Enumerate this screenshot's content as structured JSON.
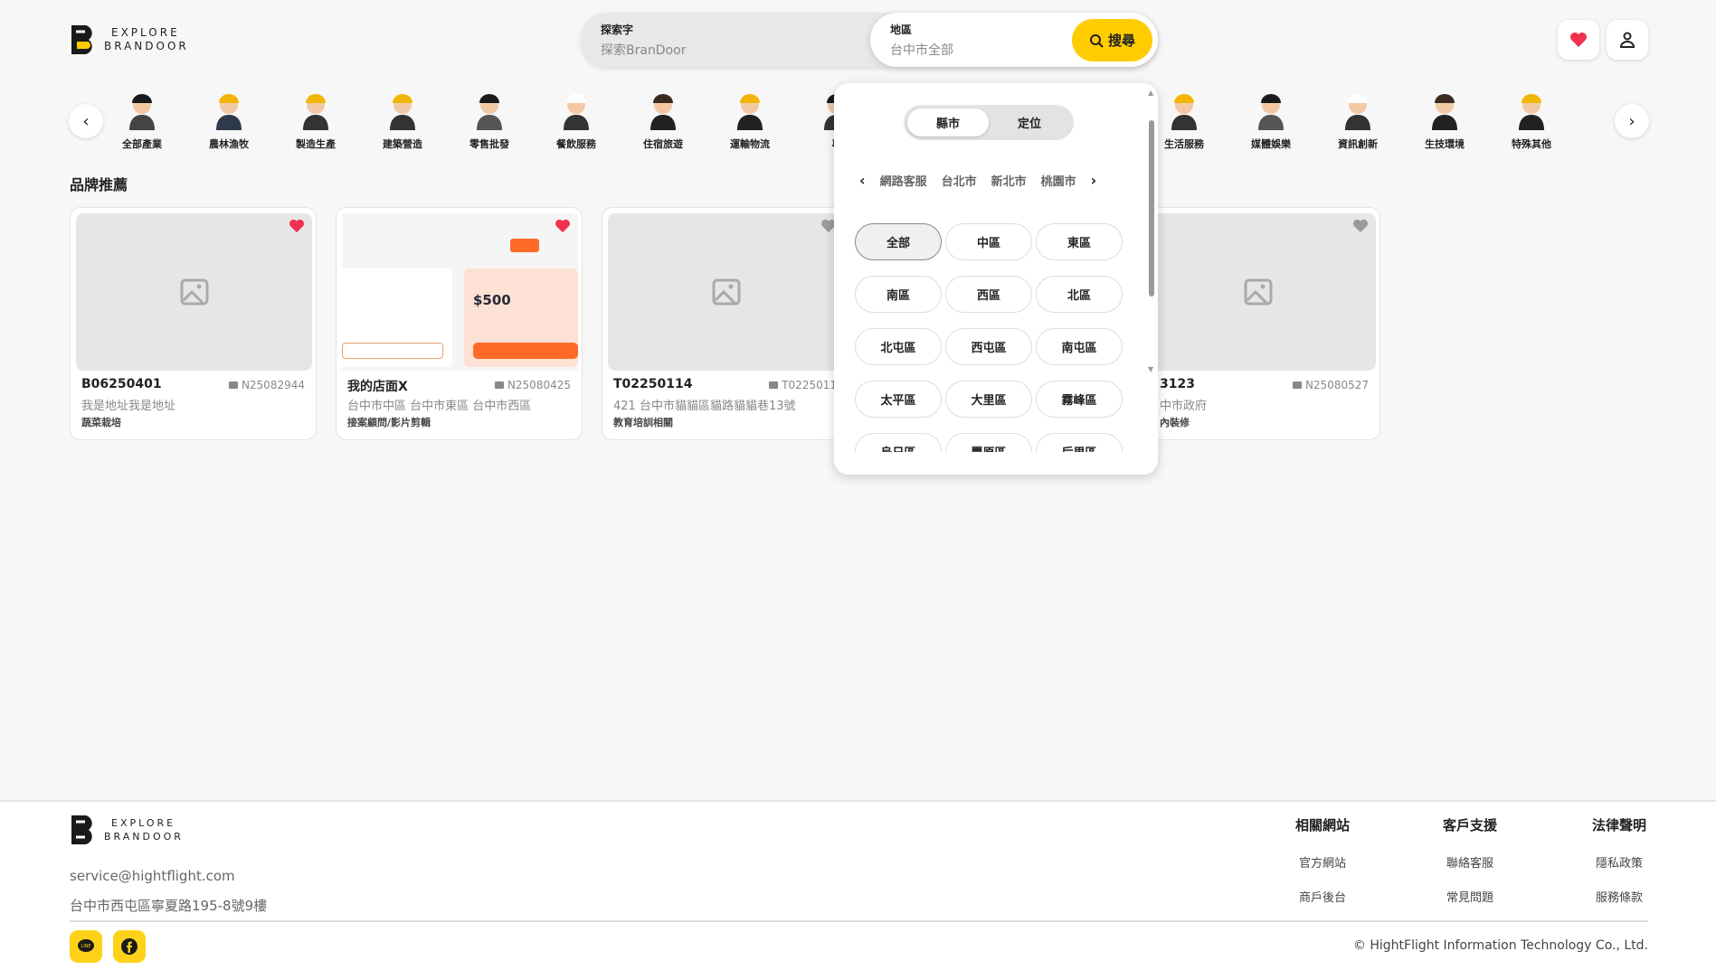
{
  "header": {
    "logo_line1": "EXPLORE",
    "logo_line2": "BRANDOOR",
    "search_label": "探索字",
    "search_placeholder": "探索BranDoor",
    "region_label": "地區",
    "region_value": "台中市全部",
    "search_button": "搜尋"
  },
  "categories": [
    {
      "label": "全部產業",
      "slot": 0
    },
    {
      "label": "農林漁牧",
      "slot": 1
    },
    {
      "label": "製造生產",
      "slot": 2
    },
    {
      "label": "建築營造",
      "slot": 3
    },
    {
      "label": "零售批發",
      "slot": 4
    },
    {
      "label": "餐飲服務",
      "slot": 5
    },
    {
      "label": "住宿旅遊",
      "slot": 6
    },
    {
      "label": "運輸物流",
      "slot": 7
    },
    {
      "label": "專",
      "slot": 8
    },
    {
      "label": "生活服務",
      "slot": 12
    },
    {
      "label": "媒體娛樂",
      "slot": 13
    },
    {
      "label": "資訊創新",
      "slot": 14
    },
    {
      "label": "生技環境",
      "slot": 15
    },
    {
      "label": "特殊其他",
      "slot": 16
    }
  ],
  "section_title": "品牌推薦",
  "cards": [
    {
      "title": "B06250401",
      "id": "N25082944",
      "address": "我是地址我是地址",
      "tag": "蔬菜栽培",
      "favorited": true
    },
    {
      "title": "我的店面X",
      "id": "N25080425",
      "address": "台中市中區 台中市東區 台中市西區",
      "tag": "接案顧問/影片剪輯",
      "favorited": true,
      "price": "$500"
    },
    {
      "title": "T02250114",
      "id": "T0225011",
      "address": "421 台中市貓貓區貓路貓貓巷13號",
      "tag": "教育培訓相關",
      "favorited": false
    },
    {
      "title": "3123",
      "id": "N25080527",
      "address": "中市政府",
      "tag": "內裝修",
      "favorited": false
    }
  ],
  "popup": {
    "tabs": [
      "縣市",
      "定位"
    ],
    "active_tab": 0,
    "cities": [
      "網路客服",
      "台北市",
      "新北市",
      "桃園市"
    ],
    "districts": [
      "全部",
      "中區",
      "東區",
      "南區",
      "西區",
      "北區",
      "北屯區",
      "西屯區",
      "南屯區",
      "太平區",
      "大里區",
      "霧峰區",
      "烏日區",
      "豐原區",
      "后里區"
    ],
    "selected_district": 0
  },
  "footer": {
    "email": "service@hightflight.com",
    "address": "台中市西屯區寧夏路195-8號9樓",
    "columns": [
      {
        "title": "相關網站",
        "links": [
          "官方網站",
          "商戶後台"
        ]
      },
      {
        "title": "客戶支援",
        "links": [
          "聯絡客服",
          "常見問題"
        ]
      },
      {
        "title": "法律聲明",
        "links": [
          "隱私政策",
          "服務條款"
        ]
      }
    ],
    "copyright": "© HightFlight Information Technology Co., Ltd."
  },
  "colors": {
    "accent": "#ffcc00",
    "heart": "#f0314f",
    "orange": "#ff6a28"
  }
}
